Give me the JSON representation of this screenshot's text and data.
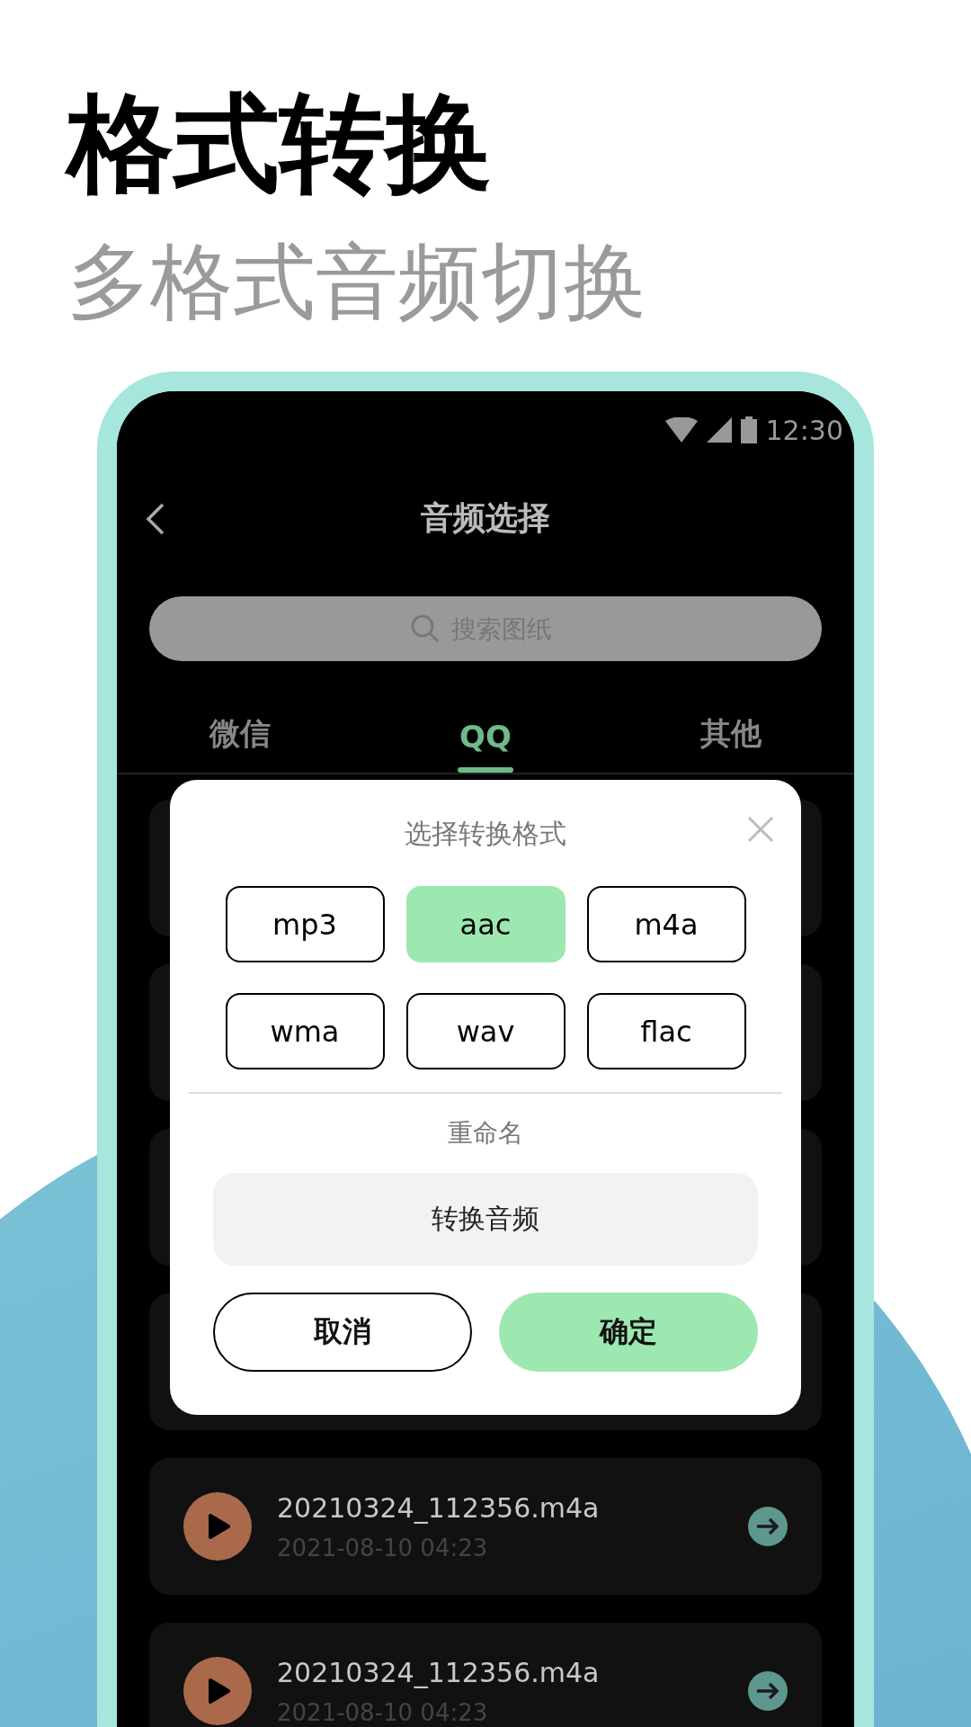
{
  "heading": "格式转换",
  "subheading": "多格式音频切换",
  "status_bar": {
    "time": "12:30"
  },
  "nav": {
    "title": "音频选择"
  },
  "search": {
    "placeholder": "搜索图纸"
  },
  "tabs": [
    {
      "label": "微信",
      "selected": false
    },
    {
      "label": "QQ",
      "selected": true
    },
    {
      "label": "其他",
      "selected": false
    }
  ],
  "files": [
    {
      "name": "20210324_112356.m4a",
      "date": "2021-08-10 04:23"
    },
    {
      "name": "20210324_112356.m4a",
      "date": "2021-08-10 04:23"
    }
  ],
  "dialog": {
    "title": "选择转换格式",
    "formats": [
      {
        "label": "mp3",
        "selected": false
      },
      {
        "label": "aac",
        "selected": true
      },
      {
        "label": "m4a",
        "selected": false
      },
      {
        "label": "wma",
        "selected": false
      },
      {
        "label": "wav",
        "selected": false
      },
      {
        "label": "flac",
        "selected": false
      }
    ],
    "rename_label": "重命名",
    "rename_value": "转换音频",
    "cancel": "取消",
    "confirm": "确定"
  }
}
